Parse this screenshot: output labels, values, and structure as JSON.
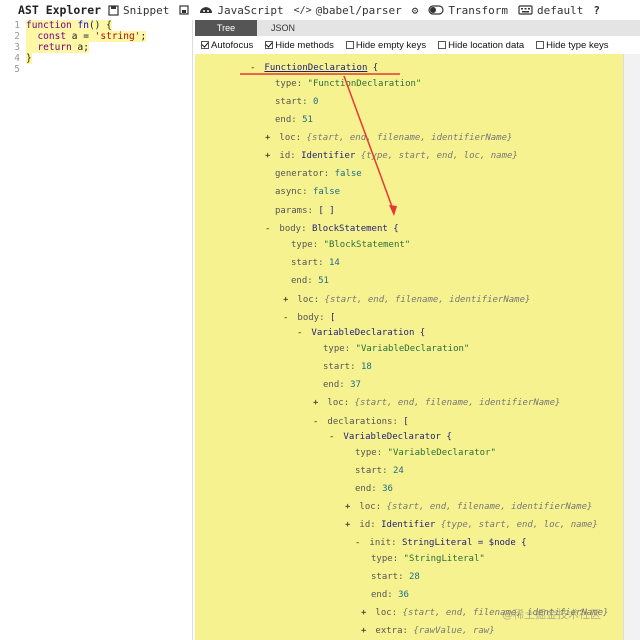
{
  "toolbar": {
    "brand": "AST Explorer",
    "snippet": "Snippet",
    "language": "JavaScript",
    "parser": "@babel/parser",
    "transform": "Transform",
    "keymap": "default",
    "help": "?"
  },
  "editor": {
    "lines": [
      {
        "num": "1",
        "text": "function fn() {"
      },
      {
        "num": "2",
        "text": "  const a = 'string';"
      },
      {
        "num": "3",
        "text": "  return a;"
      },
      {
        "num": "4",
        "text": "}"
      },
      {
        "num": "5",
        "text": ""
      }
    ]
  },
  "tabs": [
    "Tree",
    "JSON"
  ],
  "options": [
    {
      "label": "Autofocus",
      "checked": true
    },
    {
      "label": "Hide methods",
      "checked": true
    },
    {
      "label": "Hide empty keys",
      "checked": false
    },
    {
      "label": "Hide location data",
      "checked": false
    },
    {
      "label": "Hide type keys",
      "checked": false
    }
  ],
  "tree": [
    {
      "toggle": "-",
      "node": "FunctionDeclaration",
      "tail": "{",
      "link": true
    },
    {
      "key": "type",
      "str": "\"FunctionDeclaration\""
    },
    {
      "key": "start",
      "num": "0"
    },
    {
      "key": "end",
      "num": "51"
    },
    {
      "toggle": "+",
      "key": "loc",
      "it": "{start, end, filename, identifierName}"
    },
    {
      "toggle": "+",
      "key": "id",
      "node": "Identifier",
      "it": "{type, start, end, loc, name}"
    },
    {
      "key": "generator",
      "bool": "false"
    },
    {
      "key": "async",
      "bool": "false"
    },
    {
      "key": "params",
      "plain": "[ ]"
    },
    {
      "toggle": "-",
      "key": "body",
      "node": "BlockStatement",
      "tail": "{"
    },
    {
      "key": "type",
      "str": "\"BlockStatement\""
    },
    {
      "key": "start",
      "num": "14"
    },
    {
      "key": "end",
      "num": "51"
    },
    {
      "toggle": "+",
      "key": "loc",
      "it": "{start, end, filename, identifierName}"
    },
    {
      "toggle": "-",
      "key": "body",
      "plain": "["
    },
    {
      "toggle": "-",
      "node": "VariableDeclaration",
      "tail": "{"
    },
    {
      "key": "type",
      "str": "\"VariableDeclaration\""
    },
    {
      "key": "start",
      "num": "18"
    },
    {
      "key": "end",
      "num": "37"
    },
    {
      "toggle": "+",
      "key": "loc",
      "it": "{start, end, filename, identifierName}"
    },
    {
      "toggle": "-",
      "key": "declarations",
      "plain": "["
    },
    {
      "toggle": "-",
      "node": "VariableDeclarator",
      "tail": "{"
    },
    {
      "key": "type",
      "str": "\"VariableDeclarator\""
    },
    {
      "key": "start",
      "num": "24"
    },
    {
      "key": "end",
      "num": "36"
    },
    {
      "toggle": "+",
      "key": "loc",
      "it": "{start, end, filename, identifierName}"
    },
    {
      "toggle": "+",
      "key": "id",
      "node": "Identifier",
      "it": "{type, start, end, loc, name}"
    },
    {
      "toggle": "-",
      "key": "init",
      "node": "StringLiteral",
      "tail": "= $node {"
    },
    {
      "key": "type",
      "str": "\"StringLiteral\""
    },
    {
      "key": "start",
      "num": "28"
    },
    {
      "key": "end",
      "num": "36"
    },
    {
      "toggle": "+",
      "key": "loc",
      "it": "{start, end, filename, identifierName}"
    },
    {
      "toggle": "+",
      "key": "extra",
      "it": "{rawValue, raw}"
    }
  ],
  "watermark": "@稀土掘金技术社区",
  "colors": {
    "tree_bg": "#f7f290",
    "highlight": "#fdf7a6",
    "annotation": "#e53935",
    "tab_active": "#555555"
  }
}
